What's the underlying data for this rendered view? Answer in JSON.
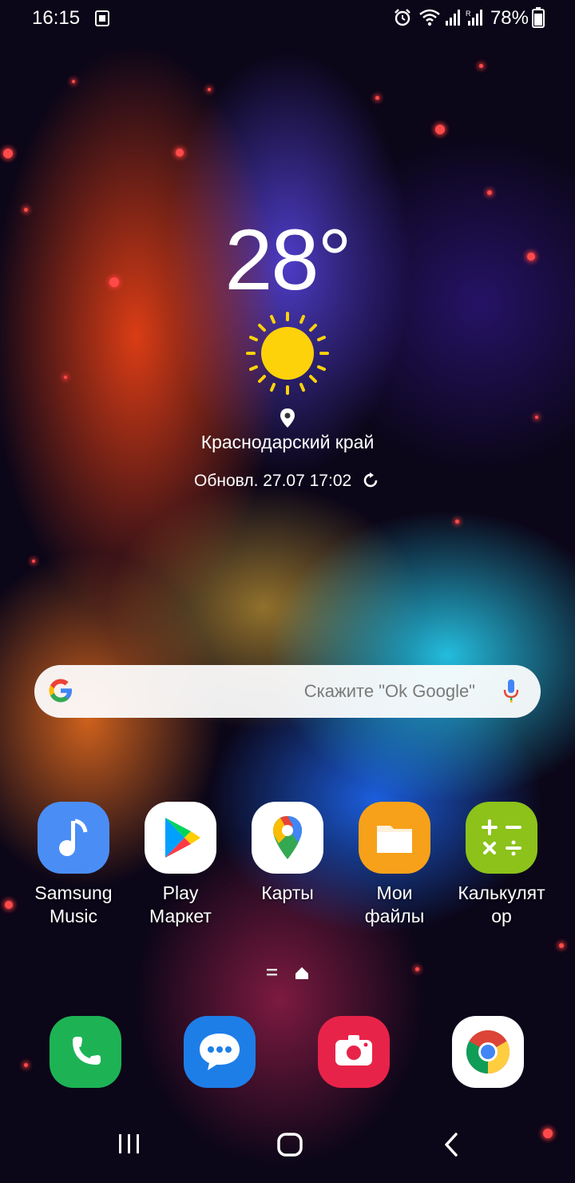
{
  "status_bar": {
    "time": "16:15",
    "battery_percent": "78%",
    "icons": [
      "screenshot-icon",
      "alarm-icon",
      "wifi-icon",
      "signal-icon",
      "signal-r-icon",
      "battery-icon"
    ]
  },
  "weather": {
    "temperature": "28°",
    "condition_icon": "sun-icon",
    "location": "Краснодарский край",
    "updated": "Обновл. 27.07 17:02"
  },
  "search": {
    "hint": "Скажите \"Ok Google\""
  },
  "apps": [
    {
      "label": "Samsung Music",
      "line1": "Samsung",
      "line2": "Music",
      "color": "#4a8ef5"
    },
    {
      "label": "Play Маркет",
      "line1": "Play",
      "line2": "Маркет",
      "color": "#ffffff"
    },
    {
      "label": "Карты",
      "line1": "Карты",
      "line2": "",
      "color": "#ffffff"
    },
    {
      "label": "Мои файлы",
      "line1": "Мои",
      "line2": "файлы",
      "color": "#f7a11a"
    },
    {
      "label": "Калькулятор",
      "line1": "Калькулят",
      "line2": "ор",
      "color": "#8cc21a"
    }
  ],
  "dock": [
    {
      "name": "phone",
      "color": "#1db355"
    },
    {
      "name": "messages",
      "color": "#1e7ee8"
    },
    {
      "name": "camera",
      "color": "#e8234a"
    },
    {
      "name": "chrome",
      "color": "#ffffff"
    }
  ],
  "navigation": [
    "recents-button",
    "home-button",
    "back-button"
  ]
}
